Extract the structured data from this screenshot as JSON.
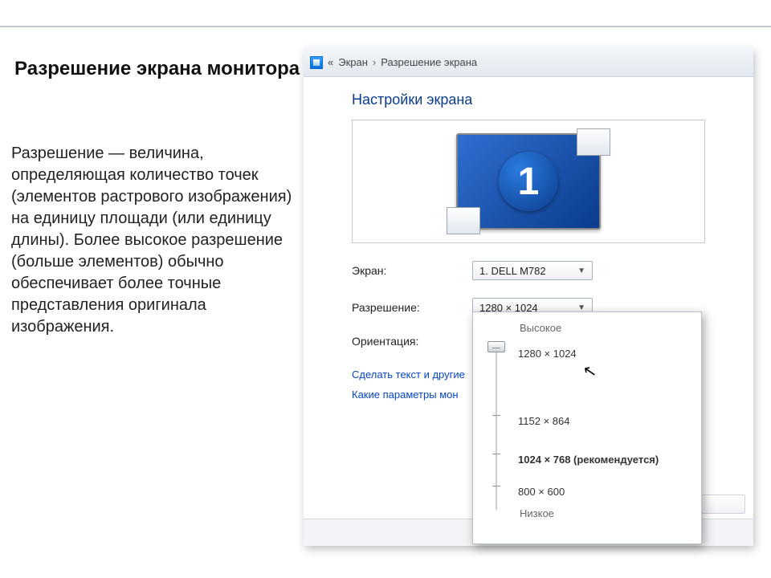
{
  "slide": {
    "title": "Разрешение экрана монитора",
    "body": "Разрешение — величина, определяющая количество точек (элементов растрового изображения) на единицу площади (или единицу длины). Более высокое разрешение (больше элементов) обычно обеспечивает более точные представления оригинала изображения."
  },
  "cp": {
    "breadcrumb_back": "«",
    "breadcrumb_root": "Экран",
    "breadcrumb_sep": "›",
    "breadcrumb_page": "Разрешение экрана",
    "heading": "Настройки экрана",
    "monitor_number": "1",
    "labels": {
      "screen": "Экран:",
      "resolution": "Разрешение:",
      "orientation": "Ориентация:"
    },
    "screen_value": "1. DELL M782",
    "resolution_value": "1280 × 1024",
    "link_text1": "Сделать текст и другие",
    "link_text2": "Какие параметры мон"
  },
  "popup": {
    "top_label": "Высокое",
    "bottom_label": "Низкое",
    "options": {
      "r1": "1280 × 1024",
      "r2": "1152 × 864",
      "r3": "1024 × 768 (рекомендуется)",
      "r4": "800 × 600"
    }
  }
}
